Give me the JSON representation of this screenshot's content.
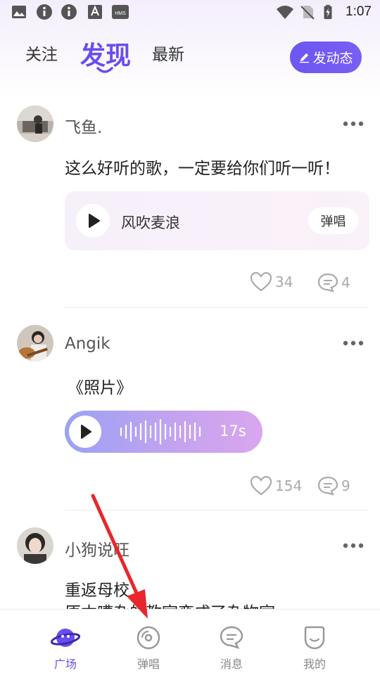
{
  "status_bar": {
    "time": "1:07",
    "icons": [
      "image-icon",
      "info-icon",
      "info-icon",
      "a-icon",
      "hms-icon",
      "wifi-icon",
      "no-sim-icon",
      "battery-charging-icon"
    ],
    "hms_label": "HMS"
  },
  "top_tabs": [
    {
      "label": "关注",
      "active": false
    },
    {
      "label": "发现",
      "active": true
    },
    {
      "label": "最新",
      "active": false
    }
  ],
  "post_button": {
    "label": "发动态",
    "icon": "pencil-icon"
  },
  "posts": [
    {
      "username": "飞鱼.",
      "text": "这么好听的歌，一定要给你们听一听！",
      "song": {
        "title": "风吹麦浪",
        "action": "弹唱"
      },
      "likes": "34",
      "comments": "4"
    },
    {
      "username": "Angik",
      "text": "《照片》",
      "voice": {
        "duration": "17s"
      },
      "likes": "154",
      "comments": "9"
    },
    {
      "username": "小狗说旺",
      "text_line1": "重返母校",
      "text_line2": "原本嘈杂的教室变成了杂物室"
    }
  ],
  "bottom_nav": [
    {
      "label": "广场",
      "icon": "planet-icon",
      "active": true
    },
    {
      "label": "弹唱",
      "icon": "record-icon",
      "active": false
    },
    {
      "label": "消息",
      "icon": "chat-icon",
      "active": false
    },
    {
      "label": "我的",
      "icon": "profile-icon",
      "active": false
    }
  ],
  "colors": {
    "accent": "#6a4cf0",
    "arrow": "#e8262b"
  }
}
